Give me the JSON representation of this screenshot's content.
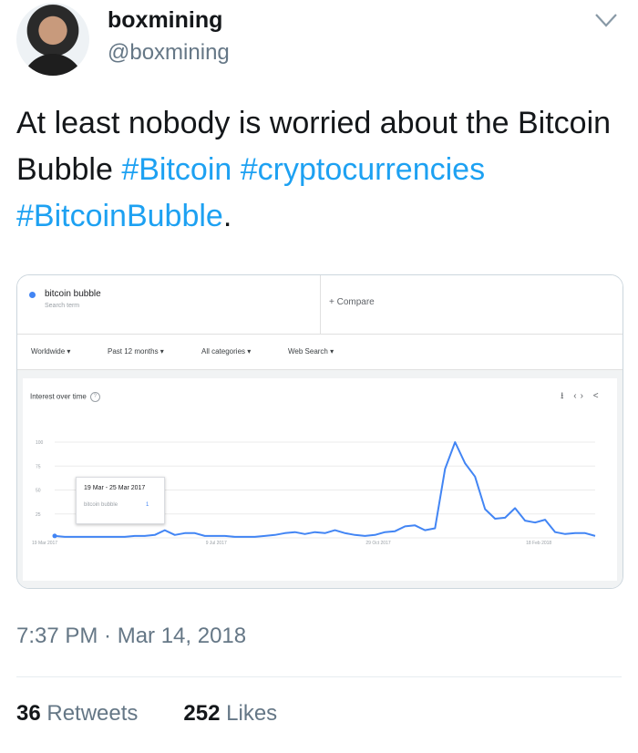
{
  "tweet": {
    "display_name": "boxmining",
    "handle": "@boxmining",
    "text_plain": "At least nobody is worried about the Bitcoin Bubble ",
    "hashtags": [
      "#Bitcoin",
      "#cryptocurrencies",
      "#BitcoinBubble"
    ],
    "text_end": ".",
    "timestamp": "7:37 PM · Mar 14, 2018",
    "retweets_count": "36",
    "retweets_label": "Retweets",
    "likes_count": "252",
    "likes_label": "Likes",
    "icons": {
      "menu": "chevron-down-icon"
    }
  },
  "trends": {
    "term": "bitcoin bubble",
    "term_sub": "Search term",
    "compare_label": "+  Compare",
    "filters": [
      "Worldwide ▾",
      "Past 12 months ▾",
      "All categories ▾",
      "Web Search ▾"
    ],
    "section_title": "Interest over time",
    "help_icon": "?",
    "action_icons": [
      "download-icon",
      "embed-icon",
      "share-icon"
    ],
    "action_icons_glyphs": "⭳ ‹› <",
    "tooltip": {
      "date_range": "19 Mar - 25 Mar 2017",
      "term": "bitcoin bubble",
      "value": "1"
    },
    "accent_color": "#4285f4"
  },
  "chart_data": {
    "type": "line",
    "title": "Interest over time",
    "y_ticks": [
      "100",
      "75",
      "50",
      "25"
    ],
    "x_tick_labels": [
      "19 Mar 2017",
      "9 Jul 2017",
      "29 Oct 2017",
      "18 Feb 2018"
    ],
    "x_tick_indices": [
      0,
      16,
      32,
      48
    ],
    "ylim": [
      0,
      100
    ],
    "grid": true,
    "series": [
      {
        "name": "bitcoin bubble",
        "color": "#4285f4",
        "values": [
          2,
          1,
          1,
          1,
          1,
          1,
          1,
          1,
          2,
          2,
          3,
          8,
          3,
          5,
          5,
          2,
          2,
          2,
          1,
          1,
          1,
          2,
          3,
          5,
          6,
          4,
          6,
          5,
          8,
          5,
          3,
          2,
          3,
          6,
          7,
          12,
          13,
          8,
          10,
          72,
          100,
          78,
          64,
          30,
          20,
          21,
          31,
          18,
          16,
          19,
          6,
          4,
          5,
          5,
          2
        ]
      }
    ]
  }
}
